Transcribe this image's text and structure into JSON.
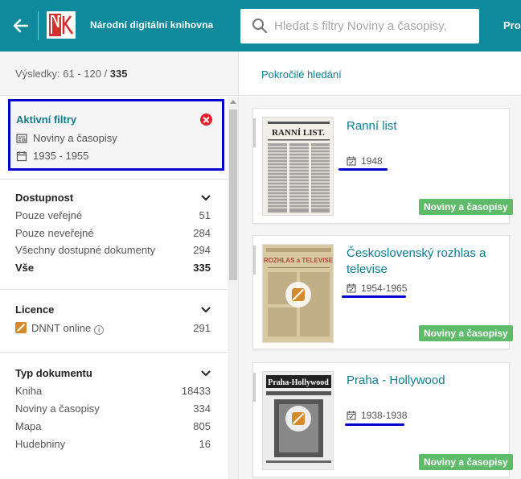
{
  "header": {
    "brand": "Národní digitální knihovna",
    "search_placeholder": "Hledat s filtry Noviny a časopisy,",
    "right_text": "Pro"
  },
  "subbar": {
    "results_prefix": "Výsledky: 61 - 120 / ",
    "results_total": "335",
    "advanced_search": "Pokročilé hledání"
  },
  "active_filters": {
    "title": "Aktivní filtry",
    "doc_type": "Noviny a časopisy",
    "date_range": "1935 - 1955"
  },
  "sections": {
    "availability": {
      "title": "Dostupnost",
      "rows": [
        {
          "label": "Pouze veřejné",
          "count": "51"
        },
        {
          "label": "Pouze neveřejné",
          "count": "284"
        },
        {
          "label": "Všechny dostupné dokumenty",
          "count": "294"
        },
        {
          "label": "Vše",
          "count": "335"
        }
      ]
    },
    "license": {
      "title": "Licence",
      "rows": [
        {
          "label": "DNNT online",
          "count": "291"
        }
      ]
    },
    "doc_type": {
      "title": "Typ dokumentu",
      "rows": [
        {
          "label": "Kniha",
          "count": "18433"
        },
        {
          "label": "Noviny a časopisy",
          "count": "334"
        },
        {
          "label": "Mapa",
          "count": "805"
        },
        {
          "label": "Hudebniny",
          "count": "16"
        }
      ]
    }
  },
  "results": [
    {
      "title": "Ranní list",
      "date": "1948",
      "badge": "Noviny a časopisy",
      "thumb_text": "RANNÍ LIST."
    },
    {
      "title": "Československý rozhlas a televise",
      "date": "1954-1965",
      "badge": "Noviny a časopisy",
      "thumb_text": "ROZHLAS a TELEVISE"
    },
    {
      "title": "Praha - Hollywood",
      "date": "1938-1938",
      "badge": "Noviny a časopisy",
      "thumb_text": "Praha-Hollywood"
    }
  ],
  "colors": {
    "header_bg": "#0e8a9c",
    "accent": "#0e7c8c",
    "badge_green": "#5fba6a",
    "annotation_blue": "#0000cc",
    "close_red": "#e0212b",
    "dnnt_orange": "#d48a2a"
  }
}
